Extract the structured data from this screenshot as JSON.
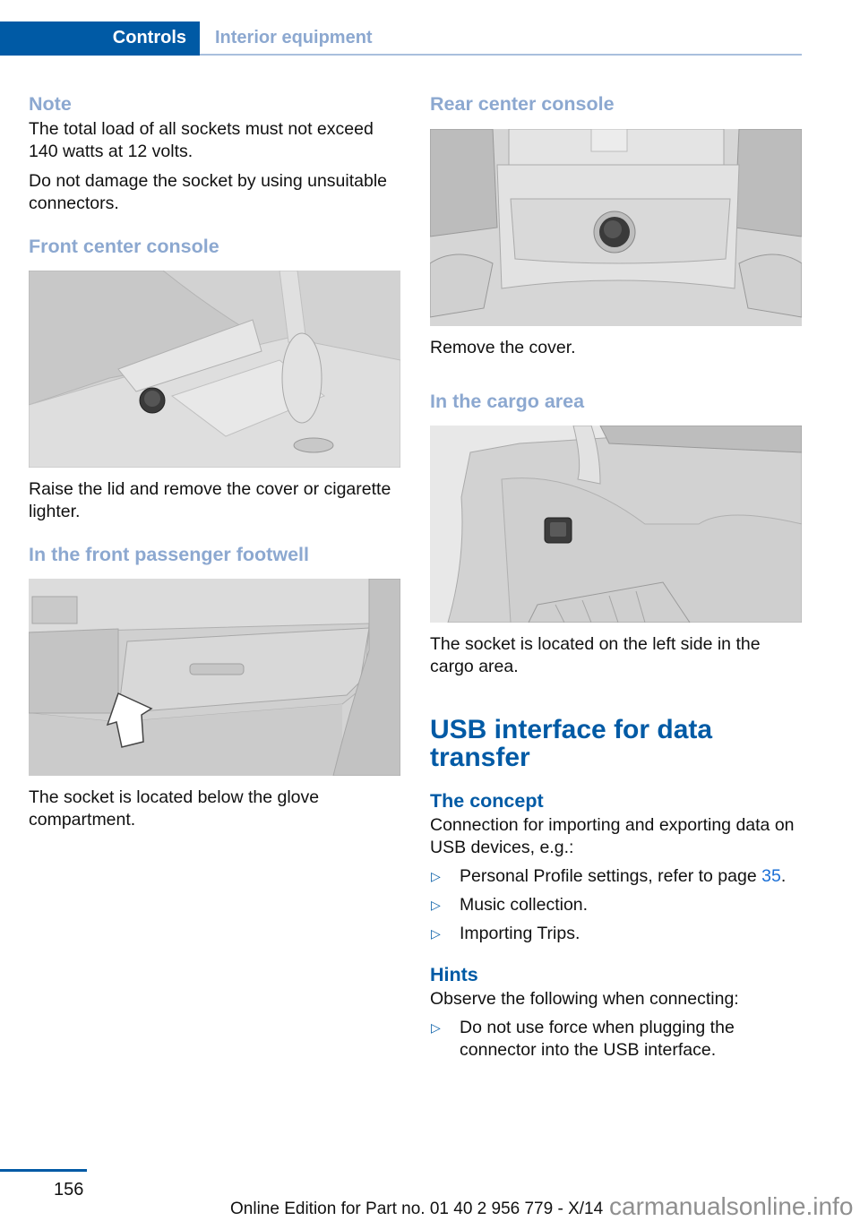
{
  "header": {
    "chapter": "Controls",
    "section": "Interior equipment"
  },
  "left_column": {
    "note": {
      "title": "Note",
      "paragraphs": [
        "The total load of all sockets must not exceed 140 watts at 12 volts.",
        "Do not damage the socket by using unsuitable connectors."
      ]
    },
    "front_center_console": {
      "heading": "Front center console",
      "image_alt": "Front center console with raised lid showing socket next to gear selector",
      "caption": "Raise the lid and remove the cover or cigarette lighter."
    },
    "front_passenger_footwell": {
      "heading": "In the front passenger footwell",
      "image_alt": "Dashboard below glove compartment with arrow pointing to socket",
      "caption": "The socket is located below the glove compartment."
    }
  },
  "right_column": {
    "rear_center_console": {
      "heading": "Rear center console",
      "image_alt": "Rear center console with round socket cover",
      "caption": "Remove the cover."
    },
    "cargo_area": {
      "heading": "In the cargo area",
      "image_alt": "Cargo area left side panel with socket and net",
      "caption": "The socket is located on the left side in the cargo area."
    },
    "usb": {
      "title": "USB interface for data transfer",
      "concept": {
        "heading": "The concept",
        "intro": "Connection for importing and exporting data on USB devices, e.g.:",
        "items": [
          {
            "text": "Personal Profile settings, refer to page ",
            "link": "35",
            "suffix": "."
          },
          {
            "text": "Music collection.",
            "link": "",
            "suffix": ""
          },
          {
            "text": "Importing Trips.",
            "link": "",
            "suffix": ""
          }
        ]
      },
      "hints": {
        "heading": "Hints",
        "intro": "Observe the following when connecting:",
        "items": [
          {
            "text": "Do not use force when plugging the connector into the USB interface."
          }
        ]
      }
    }
  },
  "footer": {
    "page_number": "156",
    "edition": "Online Edition for Part no. 01 40 2 956 779 - X/14",
    "watermark": "carmanualsonline.info"
  },
  "icons": {
    "bullet": "▷"
  },
  "colors": {
    "brand_blue": "#005aa5",
    "subheading_light_blue": "#8ca8d0",
    "link_blue": "#1a6fd6"
  }
}
